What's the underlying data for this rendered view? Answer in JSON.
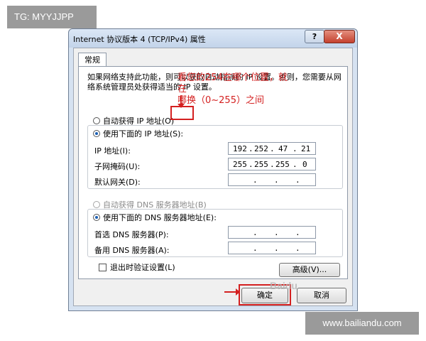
{
  "watermarks": {
    "top_left": "TG: MYYJJPP",
    "bottom_right": "www.bailiandu.com",
    "center": "Baidu"
  },
  "window": {
    "title": "Internet 协议版本 4 (TCP/IPv4) 属性",
    "help_label": "?",
    "close_label": "X"
  },
  "tab": {
    "label": "常规"
  },
  "description": "如果网络支持此功能，则可以获取自动指派的 IP 设置。否则，您需要从网络系统管理员处获得适当的 IP 设置。",
  "ip_section": {
    "auto_label": "自动获得 IP 地址(O)",
    "manual_label": "使用下面的 IP 地址(S):",
    "ip_label": "IP 地址(I):",
    "ip_value": [
      "192",
      "252",
      "47",
      "21"
    ],
    "mask_label": "子网掩码(U):",
    "mask_value": [
      "255",
      "255",
      "255",
      "0"
    ],
    "gateway_label": "默认网关(D):",
    "gateway_value": [
      "",
      "",
      "",
      ""
    ]
  },
  "dns_section": {
    "auto_label": "自动获得 DNS 服务器地址(B)",
    "manual_label": "使用下面的 DNS 服务器地址(E):",
    "preferred_label": "首选 DNS 服务器(P):",
    "alternate_label": "备用 DNS 服务器(A):"
  },
  "annotation": {
    "line1": "看您的254在哪个位置，就在",
    "line2": "哪换（0~255）之间"
  },
  "validate_label": "退出时验证设置(L)",
  "advanced_button": "高级(V)...",
  "ok_button": "确定",
  "cancel_button": "取消",
  "colors": {
    "highlight": "#d42020",
    "selected_radio": "#1a5fb4"
  }
}
